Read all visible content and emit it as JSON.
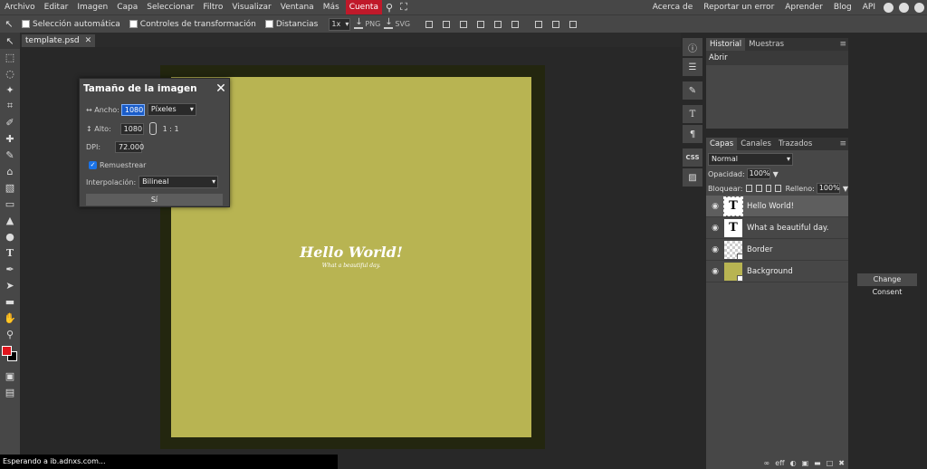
{
  "menu": {
    "items": [
      "Archivo",
      "Editar",
      "Imagen",
      "Capa",
      "Seleccionar",
      "Filtro",
      "Visualizar",
      "Ventana",
      "Más"
    ],
    "account": "Cuenta",
    "right_links": [
      "Acerca de",
      "Reportar un error",
      "Aprender",
      "Blog",
      "API"
    ]
  },
  "options": {
    "auto_select": "Selección automática",
    "transform_controls": "Controles de transformación",
    "distances": "Distancias",
    "zoom": "1x",
    "png": "PNG",
    "svg": "SVG"
  },
  "document": {
    "tab_name": "template.psd",
    "heading": "Hello World!",
    "subtext": "What a beautiful day."
  },
  "dialog": {
    "title": "Tamaño de la imagen",
    "width_label": "↔ Ancho:",
    "width_value": "1080",
    "unit": "Píxeles",
    "height_label": "↕ Alto:",
    "height_value": "1080",
    "ratio": "1 : 1",
    "dpi_label": "DPI:",
    "dpi_value": "72.000",
    "resample_label": "Remuestrear",
    "interp_label": "Interpolación:",
    "interp_value": "Bilineal",
    "ok": "Sí"
  },
  "history_panel": {
    "tabs": [
      "Historial",
      "Muestras"
    ],
    "items": [
      "Abrir"
    ]
  },
  "layers_panel": {
    "tabs": [
      "Capas",
      "Canales",
      "Trazados"
    ],
    "blend_mode": "Normal",
    "opacity_label": "Opacidad:",
    "opacity_value": "100%",
    "lock_label": "Bloquear:",
    "fill_label": "Relleno:",
    "fill_value": "100%",
    "layers": [
      {
        "name": "Hello World!"
      },
      {
        "name": "What a beautiful day."
      },
      {
        "name": "Border"
      },
      {
        "name": "Background"
      }
    ],
    "footer_eff": "eff"
  },
  "mini": {
    "css": "CSS"
  },
  "consent": "Change Consent",
  "status": "Esperando a ib.adnxs.com..."
}
